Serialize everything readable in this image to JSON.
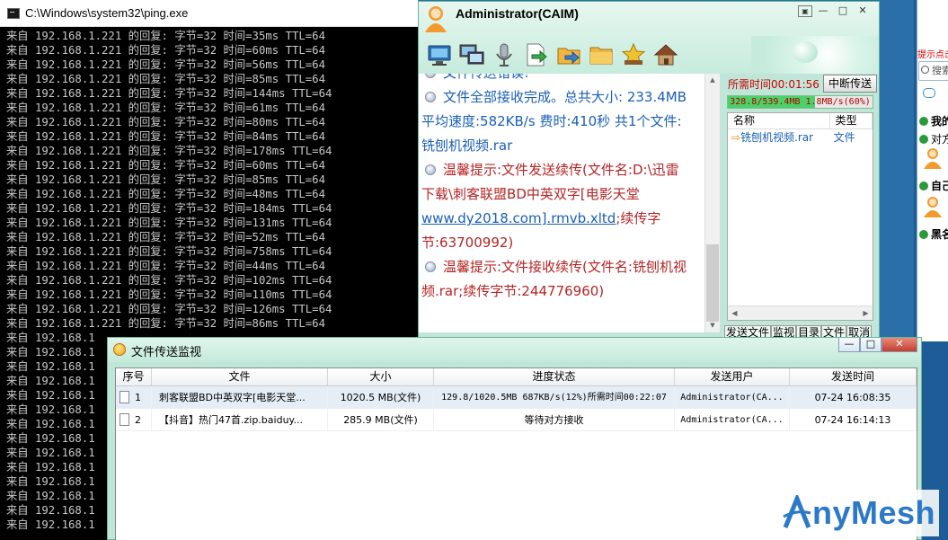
{
  "console": {
    "title": "C:\\Windows\\system32\\ping.exe",
    "lines": [
      "来自 192.168.1.221 的回复: 字节=32 时间=35ms TTL=64",
      "来自 192.168.1.221 的回复: 字节=32 时间=60ms TTL=64",
      "来自 192.168.1.221 的回复: 字节=32 时间=56ms TTL=64",
      "来自 192.168.1.221 的回复: 字节=32 时间=85ms TTL=64",
      "来自 192.168.1.221 的回复: 字节=32 时间=144ms TTL=64",
      "来自 192.168.1.221 的回复: 字节=32 时间=61ms TTL=64",
      "来自 192.168.1.221 的回复: 字节=32 时间=80ms TTL=64",
      "来自 192.168.1.221 的回复: 字节=32 时间=84ms TTL=64",
      "来自 192.168.1.221 的回复: 字节=32 时间=178ms TTL=64",
      "来自 192.168.1.221 的回复: 字节=32 时间=60ms TTL=64",
      "来自 192.168.1.221 的回复: 字节=32 时间=85ms TTL=64",
      "来自 192.168.1.221 的回复: 字节=32 时间=48ms TTL=64",
      "来自 192.168.1.221 的回复: 字节=32 时间=184ms TTL=64",
      "来自 192.168.1.221 的回复: 字节=32 时间=131ms TTL=64",
      "来自 192.168.1.221 的回复: 字节=32 时间=52ms TTL=64",
      "来自 192.168.1.221 的回复: 字节=32 时间=758ms TTL=64",
      "来自 192.168.1.221 的回复: 字节=32 时间=44ms TTL=64",
      "来自 192.168.1.221 的回复: 字节=32 时间=102ms TTL=64",
      "来自 192.168.1.221 的回复: 字节=32 时间=110ms TTL=64",
      "来自 192.168.1.221 的回复: 字节=32 时间=126ms TTL=64",
      "来自 192.168.1.221 的回复: 字节=32 时间=86ms TTL=64",
      "来自 192.168.1",
      "来自 192.168.1",
      "来自 192.168.1",
      "来自 192.168.1",
      "来自 192.168.1",
      "来自 192.168.1",
      "来自 192.168.1",
      "来自 192.168.1",
      "来自 192.168.1",
      "来自 192.168.1",
      "来自 192.168.1",
      "来自 192.168.1",
      "来自 192.168.1",
      "来自 192.168.1"
    ]
  },
  "chat": {
    "title": "Administrator(CAIM)",
    "window_buttons": [
      "▣",
      "—",
      "□",
      "✕"
    ],
    "toolbar_icons": [
      "monitor-icon",
      "remote-desktop-icon",
      "microphone-icon",
      "send-file-icon",
      "send-folder-icon",
      "folder-icon",
      "star-icon",
      "home-icon"
    ],
    "messages": {
      "m0": "文件传送错误!",
      "m1_line1": "文件全部接收完成。总共大小: 233.4MB",
      "m1_line2": "平均速度:582KB/s 费时:410秒  共1个文件:",
      "m1_line3": "铣刨机视频.rar",
      "m2_line1": "温馨提示:文件发送续传(文件名:D:\\迅雷",
      "m2_line2": "下载\\刺客联盟BD中英双字[电影天堂",
      "m2_link": "www.dy2018.com].rmvb.xltd",
      "m2_tail": ";续传字",
      "m2_line4": "节:63700992)",
      "m3_line1": "温馨提示:文件接收续传(文件名:铣刨机视",
      "m3_line2": "频.rar;续传字节:244776960)"
    },
    "side": {
      "elapsed": "所需时间00:01:56",
      "stop_button": "中断传送",
      "progress_text": "328.8/539.4MB 1.8MB/s(60%)",
      "progress_fraction": 0.6,
      "columns": [
        "名称",
        "类型"
      ],
      "file_name": "铣刨机视频.rar",
      "file_type": "文件",
      "tabs": [
        "发送文件",
        "监视",
        "目录",
        "文件",
        "取消"
      ]
    }
  },
  "edge": {
    "hint": "提示点击",
    "search": "搜索",
    "rows": [
      "我的",
      "对方",
      "自己",
      "黑名"
    ]
  },
  "monitor": {
    "title": "文件传送监视",
    "buttons": [
      "—",
      "□",
      "✕"
    ],
    "columns": [
      "序号",
      "文件",
      "大小",
      "进度状态",
      "发送用户",
      "发送时间"
    ],
    "rows": [
      {
        "num": "1",
        "file": "刺客联盟BD中英双字[电影天堂...",
        "size": "1020.5 MB(文件)",
        "status": "129.8/1020.5MB 687KB/s(12%)所需时间00:22:07",
        "user": "Administrator(CA...",
        "time": "07-24 16:08:35"
      },
      {
        "num": "2",
        "file": "【抖音】热门47首.zip.baiduy...",
        "size": "285.9 MB(文件)",
        "status": "等待对方接收",
        "user": "Administrator(CA...",
        "time": "07-24 16:14:13"
      }
    ]
  },
  "brand": {
    "name": "nyMesh",
    "logo_letter": "A"
  }
}
